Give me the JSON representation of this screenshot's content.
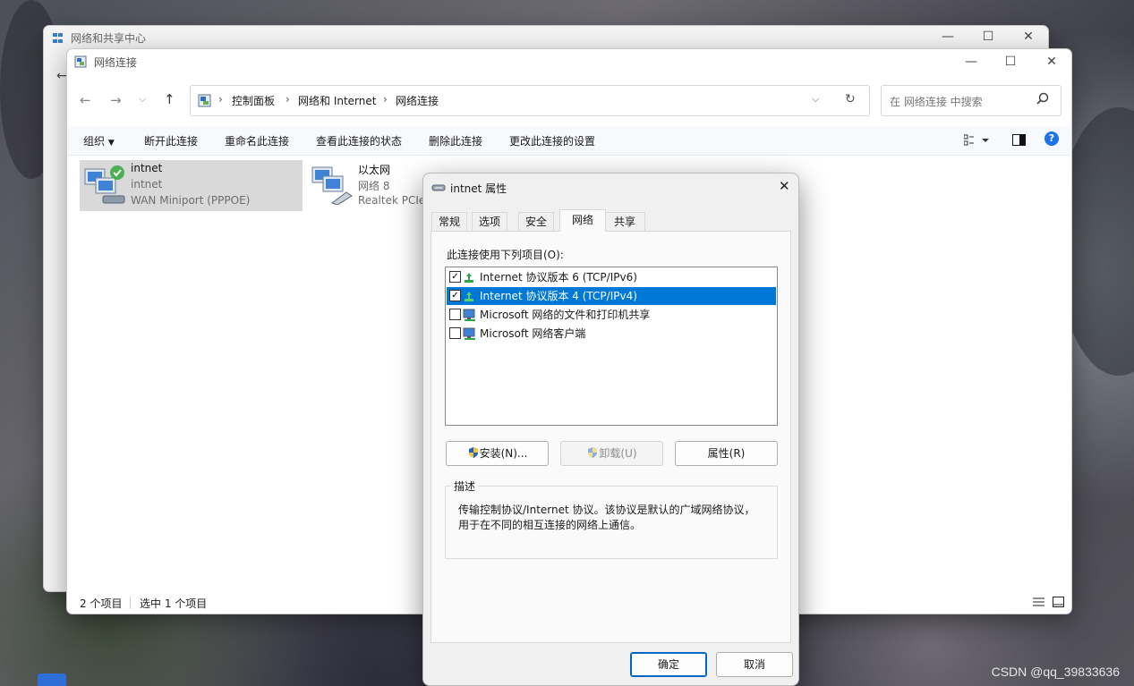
{
  "back_window": {
    "title": "网络和共享中心"
  },
  "explorer": {
    "title": "网络连接",
    "breadcrumb": [
      "控制面板",
      "网络和 Internet",
      "网络连接"
    ],
    "search_placeholder": "在 网络连接 中搜索",
    "commands": [
      "组织",
      "断开此连接",
      "重命名此连接",
      "查看此连接的状态",
      "删除此连接",
      "更改此连接的设置"
    ],
    "items": [
      {
        "name": "intnet",
        "line2": "intnet",
        "line3": "WAN Miniport (PPPOE)",
        "selected": true,
        "status": "connected"
      },
      {
        "name": "以太网",
        "line2": "网络 8",
        "line3": "Realtek PCIe",
        "selected": false
      }
    ],
    "status": {
      "count": "2 个项目",
      "selection": "选中 1 个项目"
    }
  },
  "dialog": {
    "title": "intnet 属性",
    "tabs": [
      "常规",
      "选项",
      "安全",
      "网络",
      "共享"
    ],
    "active_tab": "网络",
    "list_label": "此连接使用下列项目(O):",
    "items": [
      {
        "label": "Internet 协议版本 6 (TCP/IPv6)",
        "checked": true,
        "selected": false,
        "icon": "protocol-icon"
      },
      {
        "label": "Internet 协议版本 4 (TCP/IPv4)",
        "checked": true,
        "selected": true,
        "icon": "protocol-icon"
      },
      {
        "label": "Microsoft 网络的文件和打印机共享",
        "checked": false,
        "selected": false,
        "icon": "network-client-icon"
      },
      {
        "label": "Microsoft 网络客户端",
        "checked": false,
        "selected": false,
        "icon": "network-client-icon"
      }
    ],
    "buttons": {
      "install": "安装(N)...",
      "uninstall": "卸载(U)",
      "properties": "属性(R)"
    },
    "description_label": "描述",
    "description": "传输控制协议/Internet 协议。该协议是默认的广域网络协议，\n用于在不同的相互连接的网络上通信。",
    "ok": "确定",
    "cancel": "取消"
  },
  "watermark": "CSDN @qq_39833636",
  "colors": {
    "accent": "#0078d7",
    "help": "#1a73e8"
  }
}
